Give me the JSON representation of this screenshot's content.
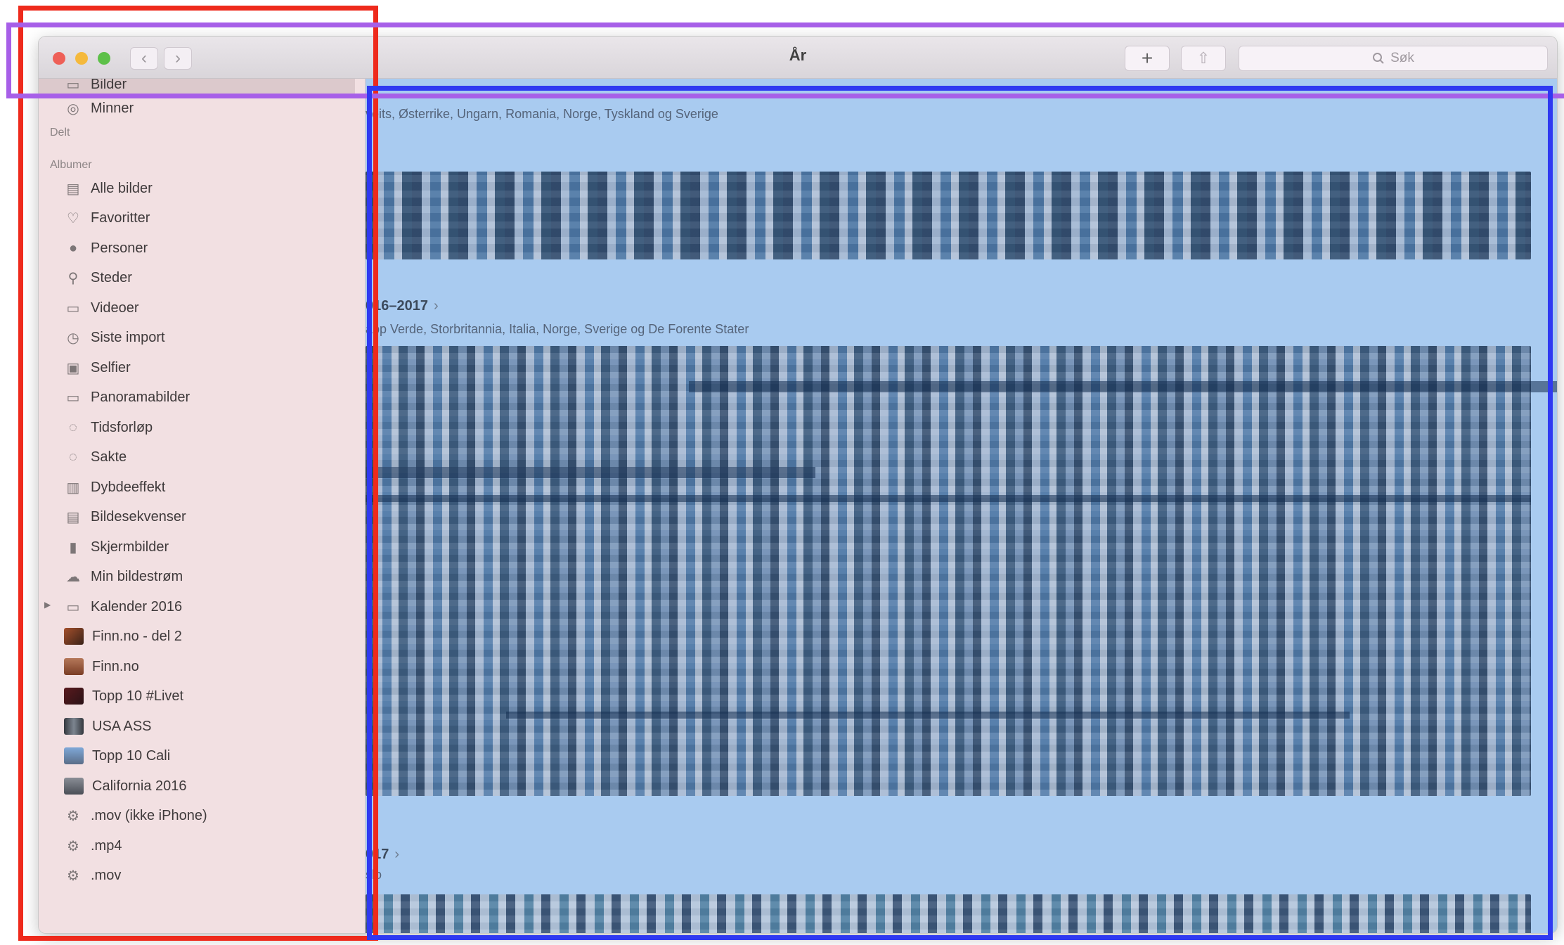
{
  "window": {
    "title": "År",
    "search_placeholder": "Søk",
    "add_label": "+",
    "share_label": "⇧"
  },
  "sidebar": {
    "items_top": [
      {
        "label": "Bilder",
        "icon": "photos-icon"
      },
      {
        "label": "Minner",
        "icon": "memories-icon"
      }
    ],
    "shared_heading": "Delt",
    "albums_heading": "Albumer",
    "albums": [
      {
        "label": "Alle bilder",
        "icon": "all-photos-icon"
      },
      {
        "label": "Favoritter",
        "icon": "heart-icon"
      },
      {
        "label": "Personer",
        "icon": "person-icon"
      },
      {
        "label": "Steder",
        "icon": "pin-icon"
      },
      {
        "label": "Videoer",
        "icon": "video-icon"
      },
      {
        "label": "Siste import",
        "icon": "clock-icon"
      },
      {
        "label": "Selfier",
        "icon": "selfie-icon"
      },
      {
        "label": "Panoramabilder",
        "icon": "panorama-icon"
      },
      {
        "label": "Tidsforløp",
        "icon": "timelapse-icon"
      },
      {
        "label": "Sakte",
        "icon": "slomo-icon"
      },
      {
        "label": "Dybdeeffekt",
        "icon": "depth-icon"
      },
      {
        "label": "Bildesekvenser",
        "icon": "burst-icon"
      },
      {
        "label": "Skjermbilder",
        "icon": "screenshot-icon"
      },
      {
        "label": "Min bildestrøm",
        "icon": "cloud-icon"
      },
      {
        "label": "Kalender 2016",
        "icon": "folder-icon"
      },
      {
        "label": "Finn.no - del 2",
        "icon": "album-thumb-icon"
      },
      {
        "label": "Finn.no",
        "icon": "album-thumb-icon"
      },
      {
        "label": "Topp 10 #Livet",
        "icon": "album-thumb-icon"
      },
      {
        "label": "USA ASS",
        "icon": "album-thumb-icon"
      },
      {
        "label": "Topp 10 Cali",
        "icon": "album-thumb-icon"
      },
      {
        "label": "California 2016",
        "icon": "album-thumb-icon"
      },
      {
        "label": ".mov (ikke iPhone)",
        "icon": "smart-album-gear-icon"
      },
      {
        "label": ".mp4",
        "icon": "smart-album-gear-icon"
      },
      {
        "label": ".mov",
        "icon": "smart-album-gear-icon"
      }
    ]
  },
  "main": {
    "sections": [
      {
        "year": "",
        "places": "veits, Østerrike, Ungarn, Romania, Norge, Tyskland og Sverige"
      },
      {
        "year": "016–2017",
        "places": "app Verde, Storbritannia, Italia, Norge, Sverige og De Forente Stater"
      },
      {
        "year": "017",
        "places": "slo"
      }
    ]
  },
  "colors": {
    "sidebar_bg": "#f2e0e2",
    "main_bg": "#a9cbf0",
    "annotation_red": "#ee2a1c",
    "annotation_purple": "#a75fe8",
    "annotation_blue": "#2f39f1"
  }
}
